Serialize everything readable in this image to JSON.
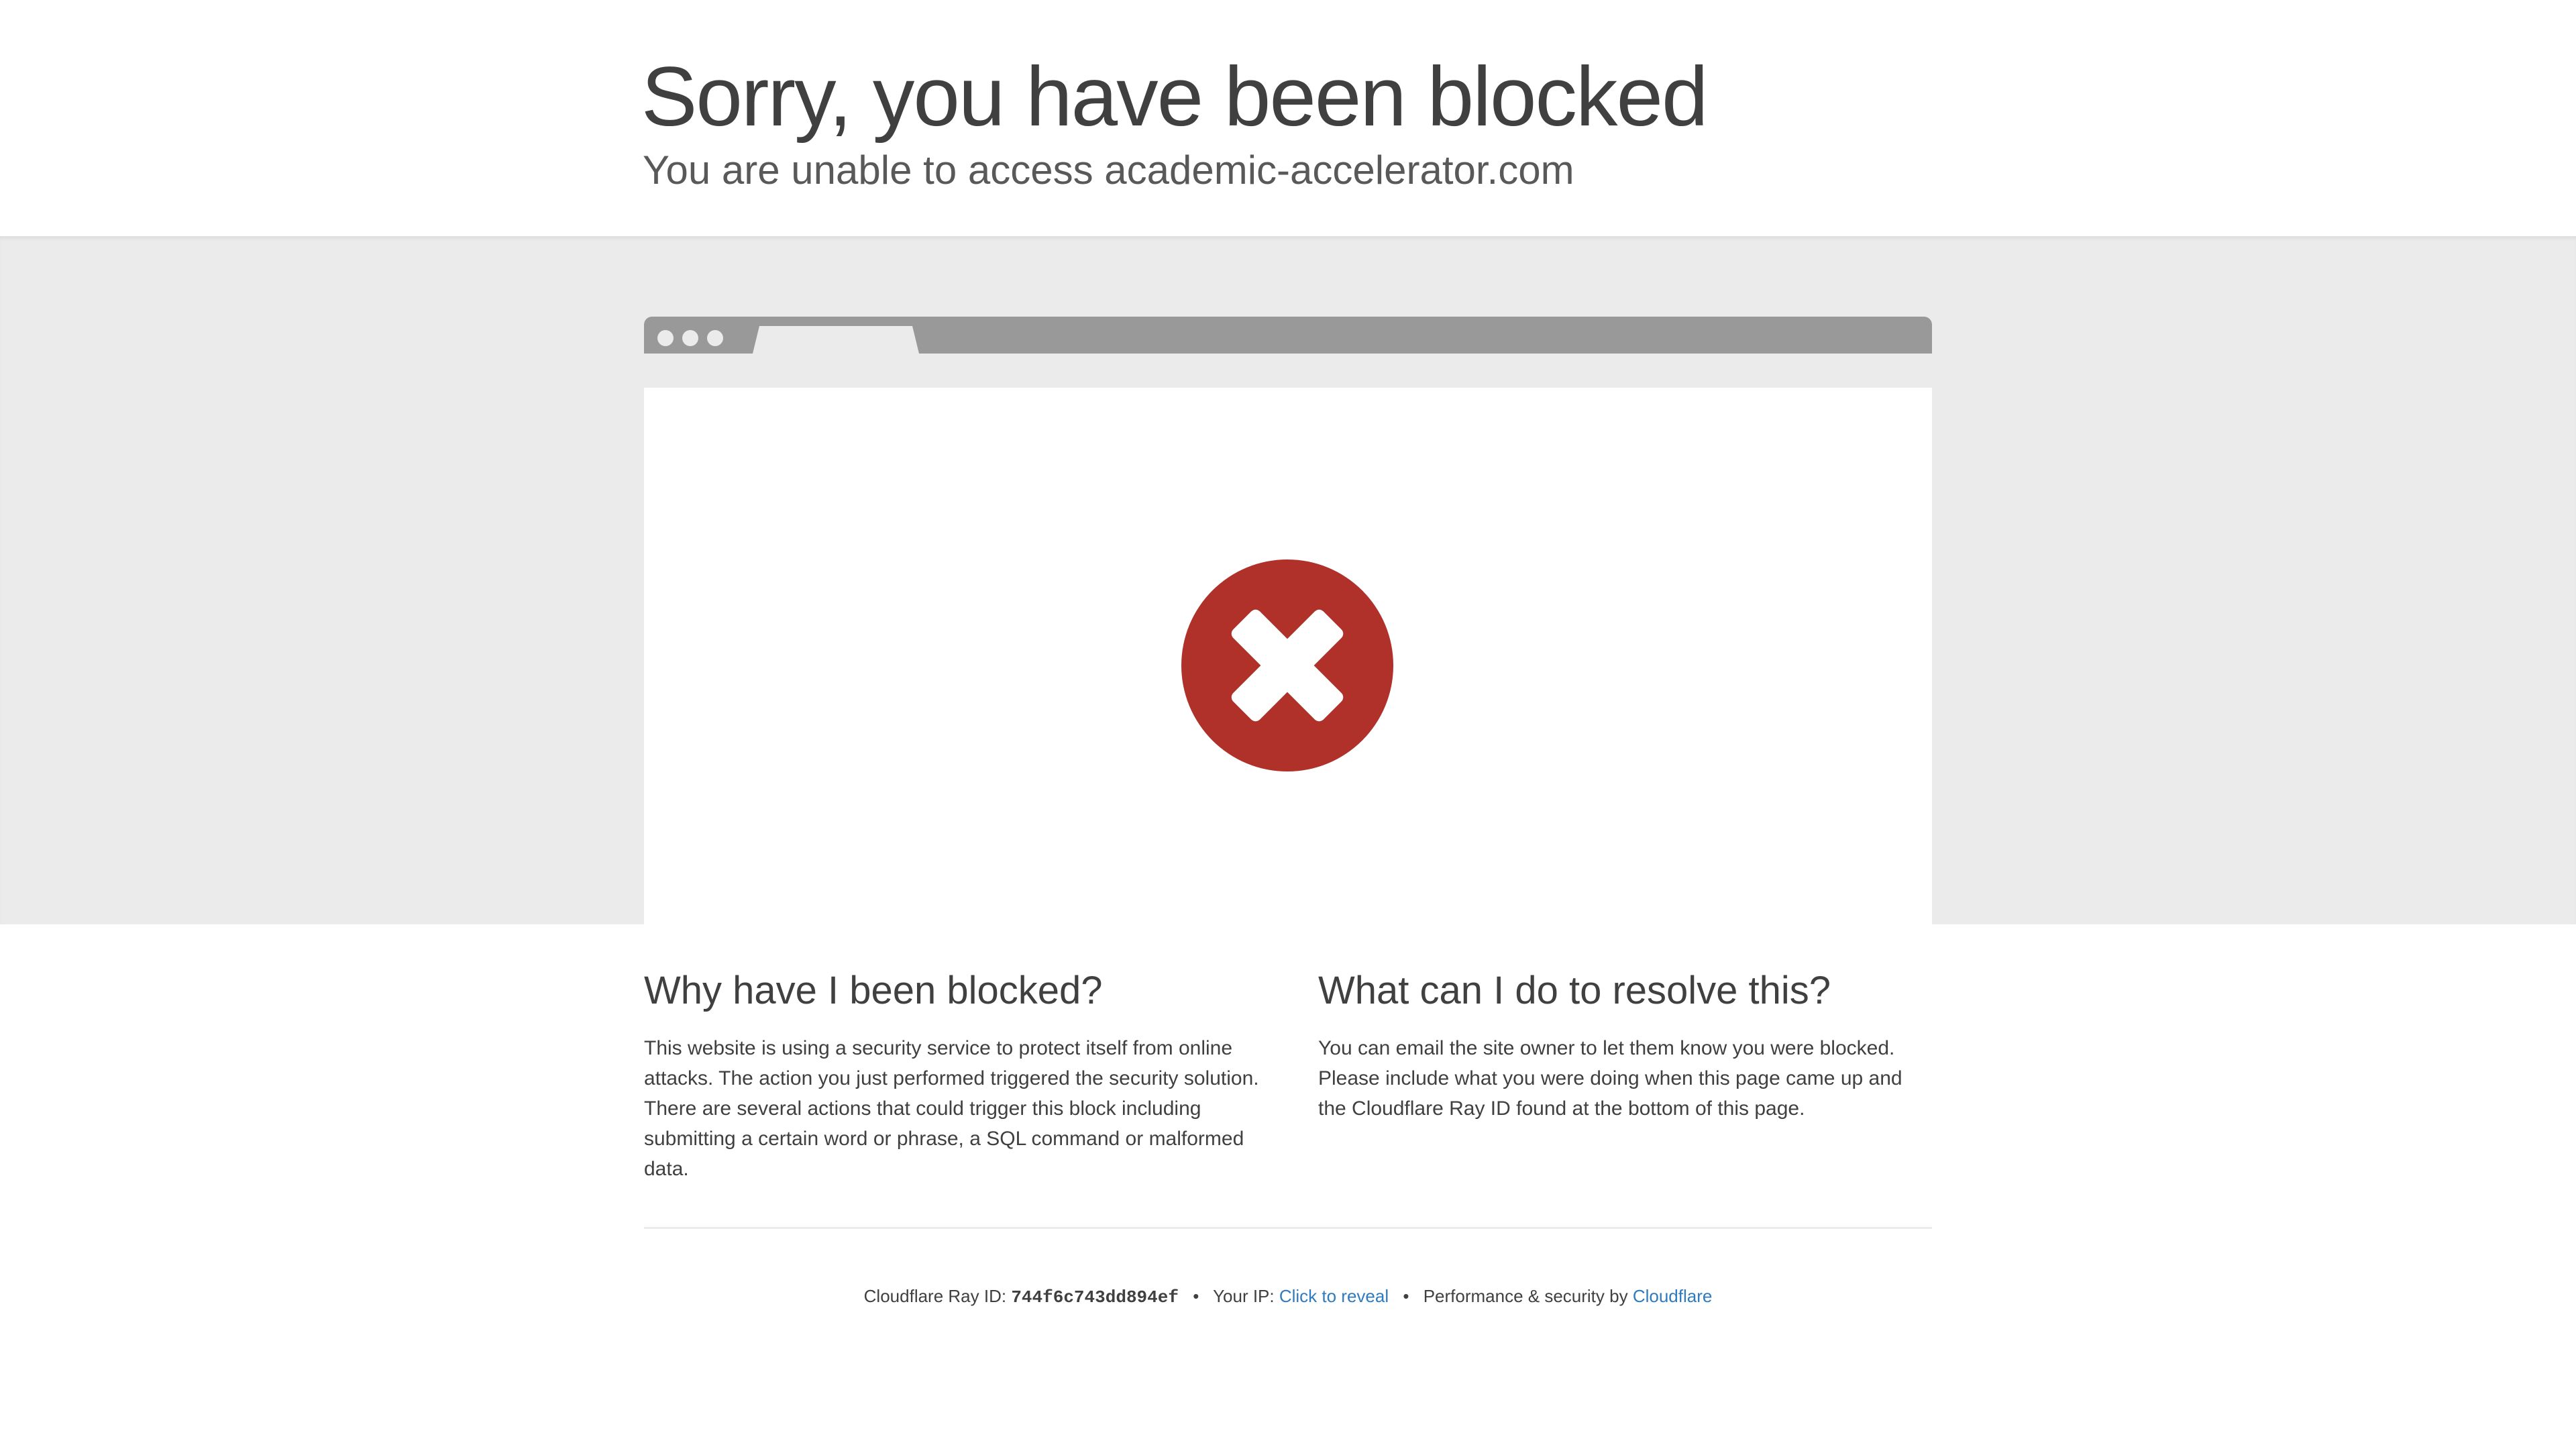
{
  "header": {
    "title": "Sorry, you have been blocked",
    "subtitle": "You are unable to access academic-accelerator.com"
  },
  "illustration": {
    "icon": "error-x-icon",
    "icon_color": "#b0302a"
  },
  "why": {
    "heading": "Why have I been blocked?",
    "body": "This website is using a security service to protect itself from online attacks. The action you just performed triggered the security solution. There are several actions that could trigger this block including submitting a certain word or phrase, a SQL command or malformed data."
  },
  "resolve": {
    "heading": "What can I do to resolve this?",
    "body": "You can email the site owner to let them know you were blocked. Please include what you were doing when this page came up and the Cloudflare Ray ID found at the bottom of this page."
  },
  "footer": {
    "ray_label": "Cloudflare Ray ID: ",
    "ray_id": "744f6c743dd894ef",
    "separator": "•",
    "ip_label": "Your IP: ",
    "ip_link": "Click to reveal",
    "perf_label": "Performance & security by ",
    "perf_link": "Cloudflare",
    "link_color": "#2f7bbf"
  }
}
